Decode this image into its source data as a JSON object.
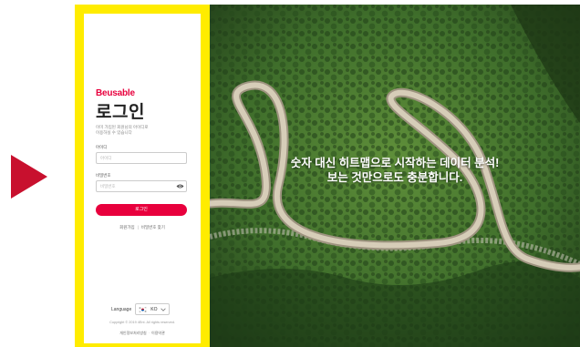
{
  "login": {
    "brand": "Beusable",
    "title": "로그인",
    "description": [
      "이미 가입된 회원님의 아이디로",
      "이용하실 수 있습니다"
    ],
    "id_label": "아이디",
    "id_placeholder": "아이디",
    "password_label": "비밀번호",
    "password_placeholder": "비밀번호",
    "submit_label": "로그인",
    "signup_link": "회원가입",
    "find_password_link": "비밀번호 찾기",
    "language_label": "Language",
    "language_value": "KO",
    "copyright": "Copyright © 2019 4Ent. All rights reserved.",
    "privacy_link": "개인정보처리방침",
    "terms_link": "이용약관"
  },
  "hero": {
    "headline_line1": "숫자 대신 히트맵으로 시작하는 데이터 분석!",
    "headline_line2": "보는 것만으로도 충분합니다."
  },
  "colors": {
    "accent": "#e8003d",
    "frame_highlight": "#ffec00",
    "arrow": "#c8102e"
  },
  "icons": {
    "arrow": "triangle-right-icon",
    "password_toggle": "eye-icon",
    "flag": "korea-flag-icon",
    "dropdown": "chevron-down-icon"
  }
}
